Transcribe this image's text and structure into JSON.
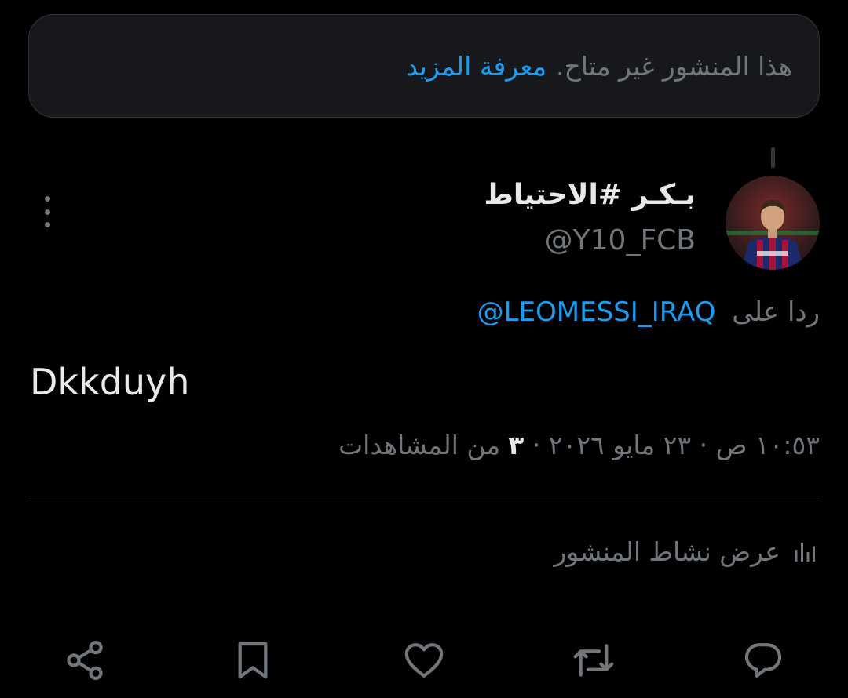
{
  "notice": {
    "message": "هذا المنشور غير متاح.",
    "link": "معرفة المزيد"
  },
  "author": {
    "display_name": "بـكـر #الاحتياط",
    "handle": "@Y10_FCB",
    "avatar_icon": "avatar-photo"
  },
  "reply": {
    "prefix": "ردا على",
    "mention": "@LEOMESSI_IRAQ"
  },
  "tweet": {
    "text": "Dkkduyh"
  },
  "meta": {
    "timestamp": "١٠:٥٣ ص · ٢٣ مايو ٢٠٢٦ ·",
    "views_count": "٣",
    "views_label": "من المشاهدات"
  },
  "activity": {
    "label": "عرض نشاط المنشور",
    "icon": "bar-chart-icon"
  },
  "actions": {
    "reply_icon": "reply-icon",
    "repost_icon": "repost-icon",
    "like_icon": "heart-icon",
    "bookmark_icon": "bookmark-icon",
    "share_icon": "share-icon"
  },
  "colors": {
    "background": "#000000",
    "text_primary": "#e7e9ea",
    "text_secondary": "#71767b",
    "accent": "#1d9bf0",
    "border": "#2f3336"
  }
}
